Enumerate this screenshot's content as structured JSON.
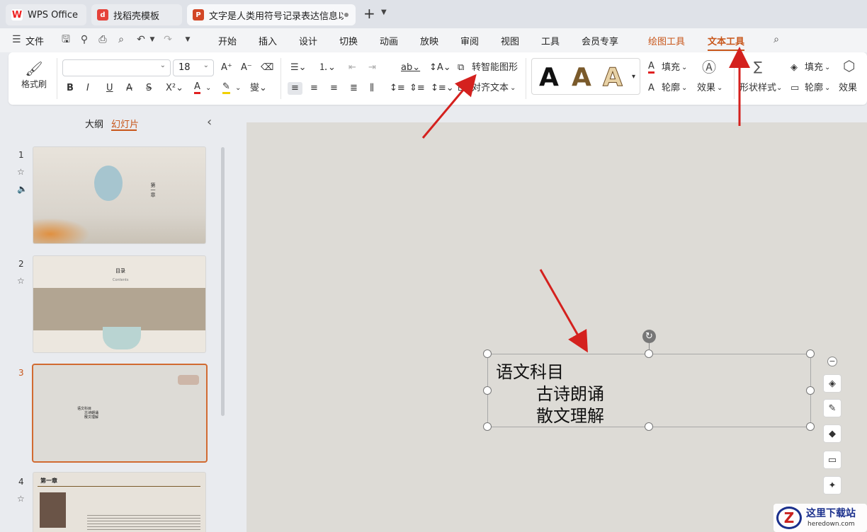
{
  "tabs": [
    {
      "label": "WPS Office",
      "icon": "wps-logo-icon"
    },
    {
      "label": "找稻壳模板",
      "icon": "docer-icon"
    },
    {
      "label": "文字是人类用符号记录表达信息以",
      "icon": "presentation-file-icon"
    }
  ],
  "titlebar": {
    "new_tab": "+",
    "dropdown": "⌄"
  },
  "menu": {
    "file": "文件",
    "items": [
      "开始",
      "插入",
      "设计",
      "切换",
      "动画",
      "放映",
      "审阅",
      "视图",
      "工具",
      "会员专享"
    ],
    "drawing_tools": "绘图工具",
    "text_tools": "文本工具"
  },
  "ribbon": {
    "format_painter": "格式刷",
    "font_name": "",
    "font_size": "18",
    "to_smart_shape": "转智能图形",
    "align_text": "对齐文本",
    "fill": "填充",
    "outline": "轮廓",
    "effects": "效果",
    "shape_style": "形状样式",
    "shape_fill": "填充",
    "shape_outline": "轮廓",
    "shape_effects": "效果",
    "art_sample": "A"
  },
  "panel": {
    "outline_tab": "大纲",
    "slides_tab": "幻灯片",
    "collapse": "‹"
  },
  "slides": [
    {
      "num": "1",
      "title": "第一章"
    },
    {
      "num": "2",
      "title": "目录",
      "subtitle": "Contents"
    },
    {
      "num": "3",
      "lines": [
        "语文科目",
        "古诗朗诵",
        "散文理解"
      ]
    },
    {
      "num": "4",
      "title": "第一章"
    }
  ],
  "canvas": {
    "lines": [
      "语文科目",
      "古诗朗诵",
      "散文理解"
    ]
  },
  "watermark": {
    "text": "这里下载站",
    "url": "heredown.com"
  },
  "colors": {
    "accent": "#c8561a",
    "arrow": "#d4211e",
    "slide_bg": "#dddbd6"
  }
}
